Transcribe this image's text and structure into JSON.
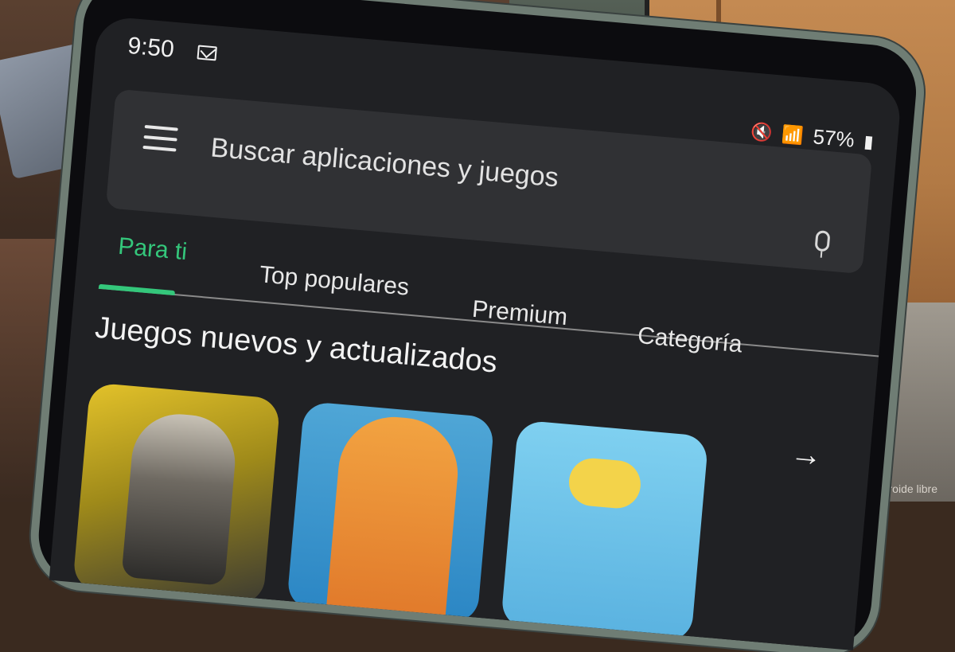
{
  "status_bar": {
    "time": "9:50",
    "notification_icon": "mail-icon",
    "battery": "57%",
    "icons": [
      "mute-icon",
      "wifi-icon",
      "signal-icon",
      "battery-icon"
    ]
  },
  "search": {
    "placeholder": "Buscar aplicaciones y juegos",
    "menu_icon": "menu-icon",
    "voice_icon": "mic-icon"
  },
  "tabs": [
    {
      "label": "Para ti",
      "active": true
    },
    {
      "label": "Top populares",
      "active": false
    },
    {
      "label": "Premium",
      "active": false
    },
    {
      "label": "Categoría",
      "active": false
    }
  ],
  "section": {
    "title": "Juegos nuevos y actualizados",
    "more_icon": "arrow-right-icon"
  },
  "watermark": "El androide libre",
  "colors": {
    "accent": "#34c77b",
    "background": "#202124",
    "searchbar": "#303134"
  }
}
